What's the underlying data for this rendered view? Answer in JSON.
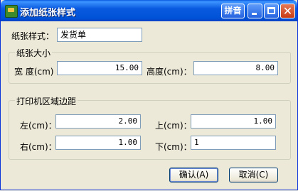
{
  "window": {
    "title": "添加纸张样式",
    "ime_label": "拼音"
  },
  "paper_style": {
    "label": "纸张样式：",
    "value": "发货单"
  },
  "paper_size": {
    "group_title": "纸张大小",
    "width_label": "宽 度(cm)",
    "width_value": "15.00",
    "height_label": "高度(cm)：",
    "height_value": "8.00"
  },
  "margins": {
    "group_title": "打印机区域边距",
    "left_label": "左(cm)：",
    "left_value": "2.00",
    "top_label": "上(cm)：",
    "top_value": "1.00",
    "right_label": "右(cm)：",
    "right_value": "1.00",
    "bottom_label": "下(cm)：",
    "bottom_value": "1"
  },
  "buttons": {
    "ok": "确认(A)",
    "cancel": "取消(C)"
  }
}
